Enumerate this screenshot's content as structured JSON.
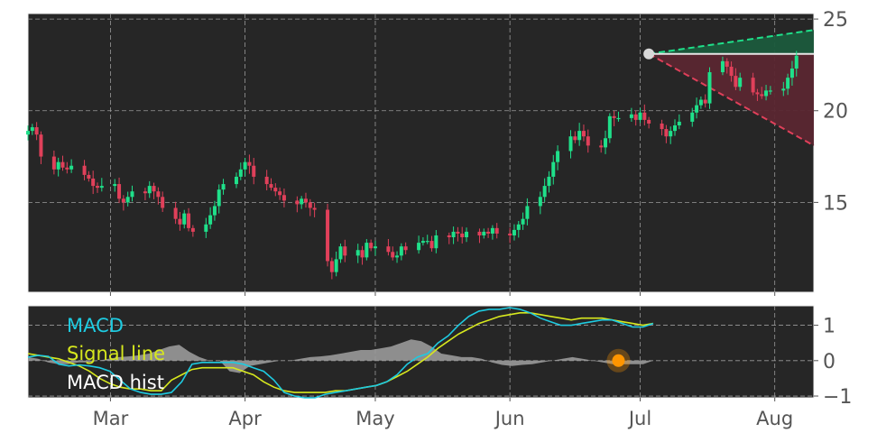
{
  "chart_data": [
    {
      "type": "candlestick",
      "x_ticks": [
        "Mar",
        "Apr",
        "May",
        "Jun",
        "Jul",
        "Aug"
      ],
      "x_tick_dates": [
        "2020-03-01",
        "2020-04-01",
        "2020-05-01",
        "2020-06-01",
        "2020-07-01",
        "2020-08-01"
      ],
      "x_range": [
        "2020-02-11",
        "2020-08-10"
      ],
      "ylim": [
        10.1,
        25.3
      ],
      "y_ticks": [
        15,
        20,
        25
      ],
      "grid": true,
      "price_close_start": "2020-02-11",
      "closes": [
        18.9,
        19.1,
        18.7,
        17.5,
        16.8,
        17.2,
        16.9,
        16.8,
        17.0,
        16.5,
        16.3,
        15.9,
        15.8,
        15.9,
        16.0,
        15.2,
        15.0,
        15.3,
        15.6,
        15.5,
        15.9,
        15.6,
        15.3,
        14.7,
        14.1,
        13.8,
        14.4,
        13.6,
        13.4,
        13.8,
        14.3,
        14.8,
        15.7,
        16.0,
        16.4,
        16.8,
        17.2,
        17.0,
        16.4,
        16.0,
        15.8,
        15.6,
        15.4,
        15.1,
        14.9,
        15.2,
        15.0,
        14.7,
        14.6,
        11.8,
        11.2,
        11.9,
        12.6,
        12.1,
        12.4,
        12.0,
        12.8,
        12.5,
        12.6,
        12.3,
        12.0,
        12.1,
        12.6,
        12.4,
        12.8,
        12.9,
        12.9,
        12.5,
        13.2,
        13.1,
        13.4,
        13.3,
        13.1,
        13.4,
        13.2,
        13.4,
        13.3,
        13.6,
        13.3,
        13.2,
        13.5,
        13.8,
        14.1,
        14.8,
        15.3,
        15.9,
        16.4,
        17.2,
        17.8,
        18.6,
        18.4,
        18.9,
        18.6,
        18.1,
        18.0,
        18.5,
        19.7,
        19.6,
        19.6,
        19.8,
        19.5,
        19.9,
        19.5,
        19.3,
        19.0,
        18.6,
        18.9,
        19.2,
        19.4,
        19.9,
        20.3,
        20.6,
        20.4,
        22.1,
        22.7,
        22.4,
        21.9,
        21.3,
        21.8,
        21.0,
        20.9,
        20.8,
        21.1,
        21.1,
        21.2,
        21.8,
        22.3,
        23.0
      ],
      "last_price": 23.0,
      "forecast": {
        "from_date": "2020-07-03",
        "to_date": "2020-08-10",
        "price": 23.1,
        "upper": 24.4,
        "lower": 18.1
      },
      "colors": {
        "up": "#1fe08a",
        "down": "#e0405a",
        "background": "#262626",
        "forecast_up": "#1fe08a",
        "forecast_down": "#e0405a"
      }
    },
    {
      "type": "line",
      "legend": [
        "MACD",
        "Signal line",
        "MACD hist"
      ],
      "legend_position": "top-left",
      "ylim": [
        -1.05,
        1.55
      ],
      "y_ticks": [
        1,
        0,
        -1
      ],
      "y_tick_labels": [
        "1",
        "0",
        "−1"
      ],
      "grid": true,
      "x_range": [
        "2020-02-11",
        "2020-08-10"
      ],
      "macd_start": "2020-02-11",
      "macd": [
        0.1,
        0.15,
        0.12,
        -0.1,
        -0.15,
        -0.12,
        -0.15,
        -0.2,
        -0.3,
        -0.55,
        -0.8,
        -0.9,
        -0.95,
        -0.95,
        -0.9,
        -0.6,
        -0.1,
        -0.05,
        -0.05,
        -0.05,
        -0.05,
        -0.1,
        -0.2,
        -0.3,
        -0.55,
        -0.9,
        -1.0,
        -1.05,
        -1.05,
        -0.95,
        -0.9,
        -0.85,
        -0.8,
        -0.75,
        -0.7,
        -0.6,
        -0.4,
        -0.1,
        0.1,
        0.2,
        0.5,
        0.7,
        1.0,
        1.25,
        1.4,
        1.45,
        1.45,
        1.5,
        1.45,
        1.35,
        1.2,
        1.1,
        1.0,
        1.0,
        1.05,
        1.1,
        1.15,
        1.15,
        1.05,
        0.95,
        0.95,
        1.05
      ],
      "signal": [
        0.2,
        0.15,
        0.1,
        0.05,
        -0.05,
        -0.15,
        -0.3,
        -0.5,
        -0.65,
        -0.75,
        -0.8,
        -0.8,
        -0.85,
        -0.85,
        -0.55,
        -0.4,
        -0.25,
        -0.2,
        -0.2,
        -0.2,
        -0.2,
        -0.3,
        -0.4,
        -0.6,
        -0.75,
        -0.85,
        -0.9,
        -0.9,
        -0.9,
        -0.9,
        -0.85,
        -0.85,
        -0.8,
        -0.75,
        -0.7,
        -0.6,
        -0.45,
        -0.3,
        -0.1,
        0.1,
        0.35,
        0.55,
        0.75,
        0.9,
        1.05,
        1.15,
        1.25,
        1.3,
        1.35,
        1.35,
        1.3,
        1.25,
        1.2,
        1.15,
        1.2,
        1.2,
        1.2,
        1.15,
        1.1,
        1.05,
        1.0,
        1.05
      ],
      "hist": [
        0.1,
        0.05,
        -0.05,
        -0.1,
        -0.1,
        -0.05,
        -0.05,
        0.0,
        0.05,
        0.1,
        0.12,
        0.15,
        0.2,
        0.3,
        0.4,
        0.45,
        0.25,
        0.1,
        0.0,
        0.0,
        -0.3,
        -0.35,
        -0.15,
        -0.1,
        -0.05,
        0.0,
        0.0,
        0.05,
        0.1,
        0.12,
        0.15,
        0.2,
        0.25,
        0.3,
        0.3,
        0.35,
        0.4,
        0.5,
        0.6,
        0.55,
        0.4,
        0.2,
        0.15,
        0.1,
        0.1,
        0.05,
        -0.05,
        -0.12,
        -0.15,
        -0.12,
        -0.1,
        -0.05,
        0.0,
        0.05,
        0.1,
        0.05,
        0.0,
        -0.05,
        -0.1,
        -0.1,
        -0.1,
        -0.1,
        0.0
      ],
      "marker": {
        "date": "2020-06-26",
        "value": 0.0,
        "color": "#ff9500"
      },
      "colors": {
        "macd": "#1ecbe1",
        "signal": "#d7e81e",
        "hist": "#9a9a9a",
        "background": "#262626"
      }
    }
  ]
}
